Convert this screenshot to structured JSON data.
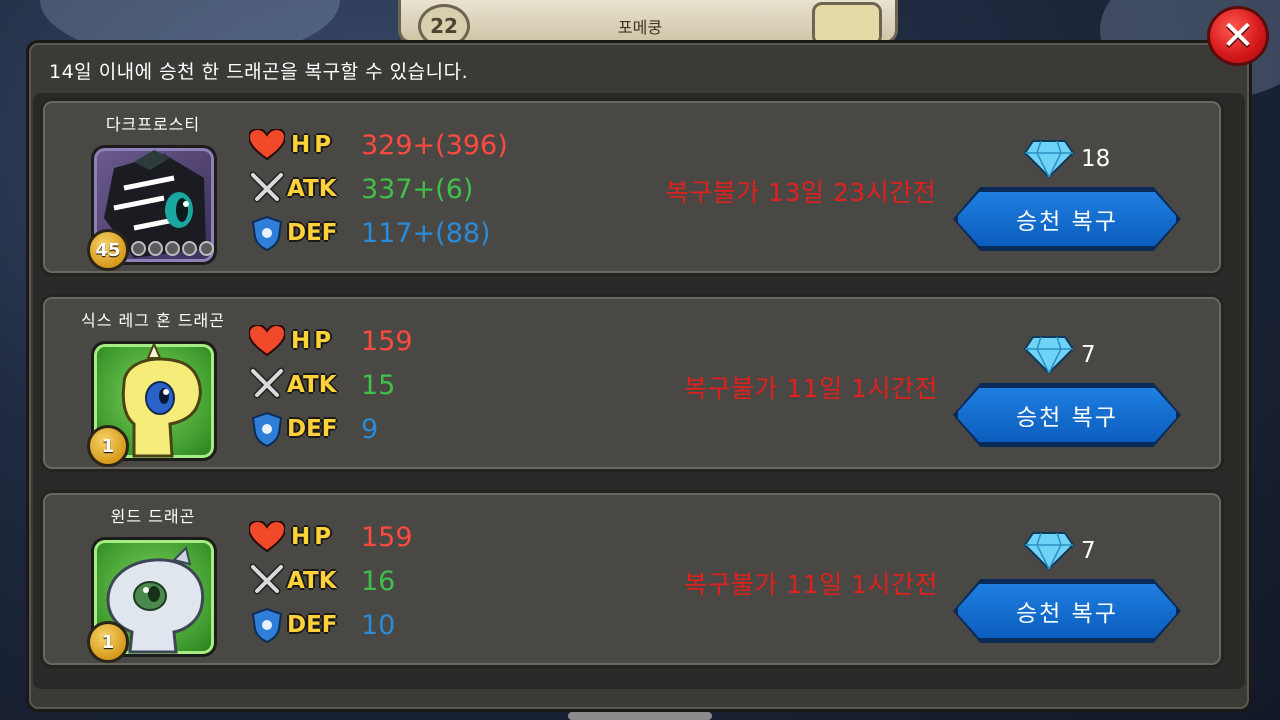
{
  "background": {
    "level": "22",
    "title": "포메쿵"
  },
  "dialog": {
    "notice": "14일 이내에 승천 한 드래곤을 복구할 수 있습니다."
  },
  "labels": {
    "hp": "HP",
    "atk": "ATK",
    "def": "DEF",
    "restore_button": "승천 복구"
  },
  "cards": [
    {
      "name": "다크프로스티",
      "level": "45",
      "hp": "329+(396)",
      "atk": "337+(6)",
      "def": "117+(88)",
      "status": "복구불가 13일 23시간전",
      "gem_cost": "18",
      "portrait_style": "purple"
    },
    {
      "name": "식스 레그 혼 드래곤",
      "level": "1",
      "hp": "159",
      "atk": "15",
      "def": "9",
      "status": "복구불가 11일 1시간전",
      "gem_cost": "7",
      "portrait_style": "green"
    },
    {
      "name": "윈드 드래곤",
      "level": "1",
      "hp": "159",
      "atk": "16",
      "def": "10",
      "status": "복구불가 11일 1시간전",
      "gem_cost": "7",
      "portrait_style": "green"
    }
  ],
  "colors": {
    "hp": "#ff4a3f",
    "atk": "#3fc04a",
    "def": "#2a8bd8",
    "status": "#e0201c",
    "button": "#1f7fe0"
  }
}
